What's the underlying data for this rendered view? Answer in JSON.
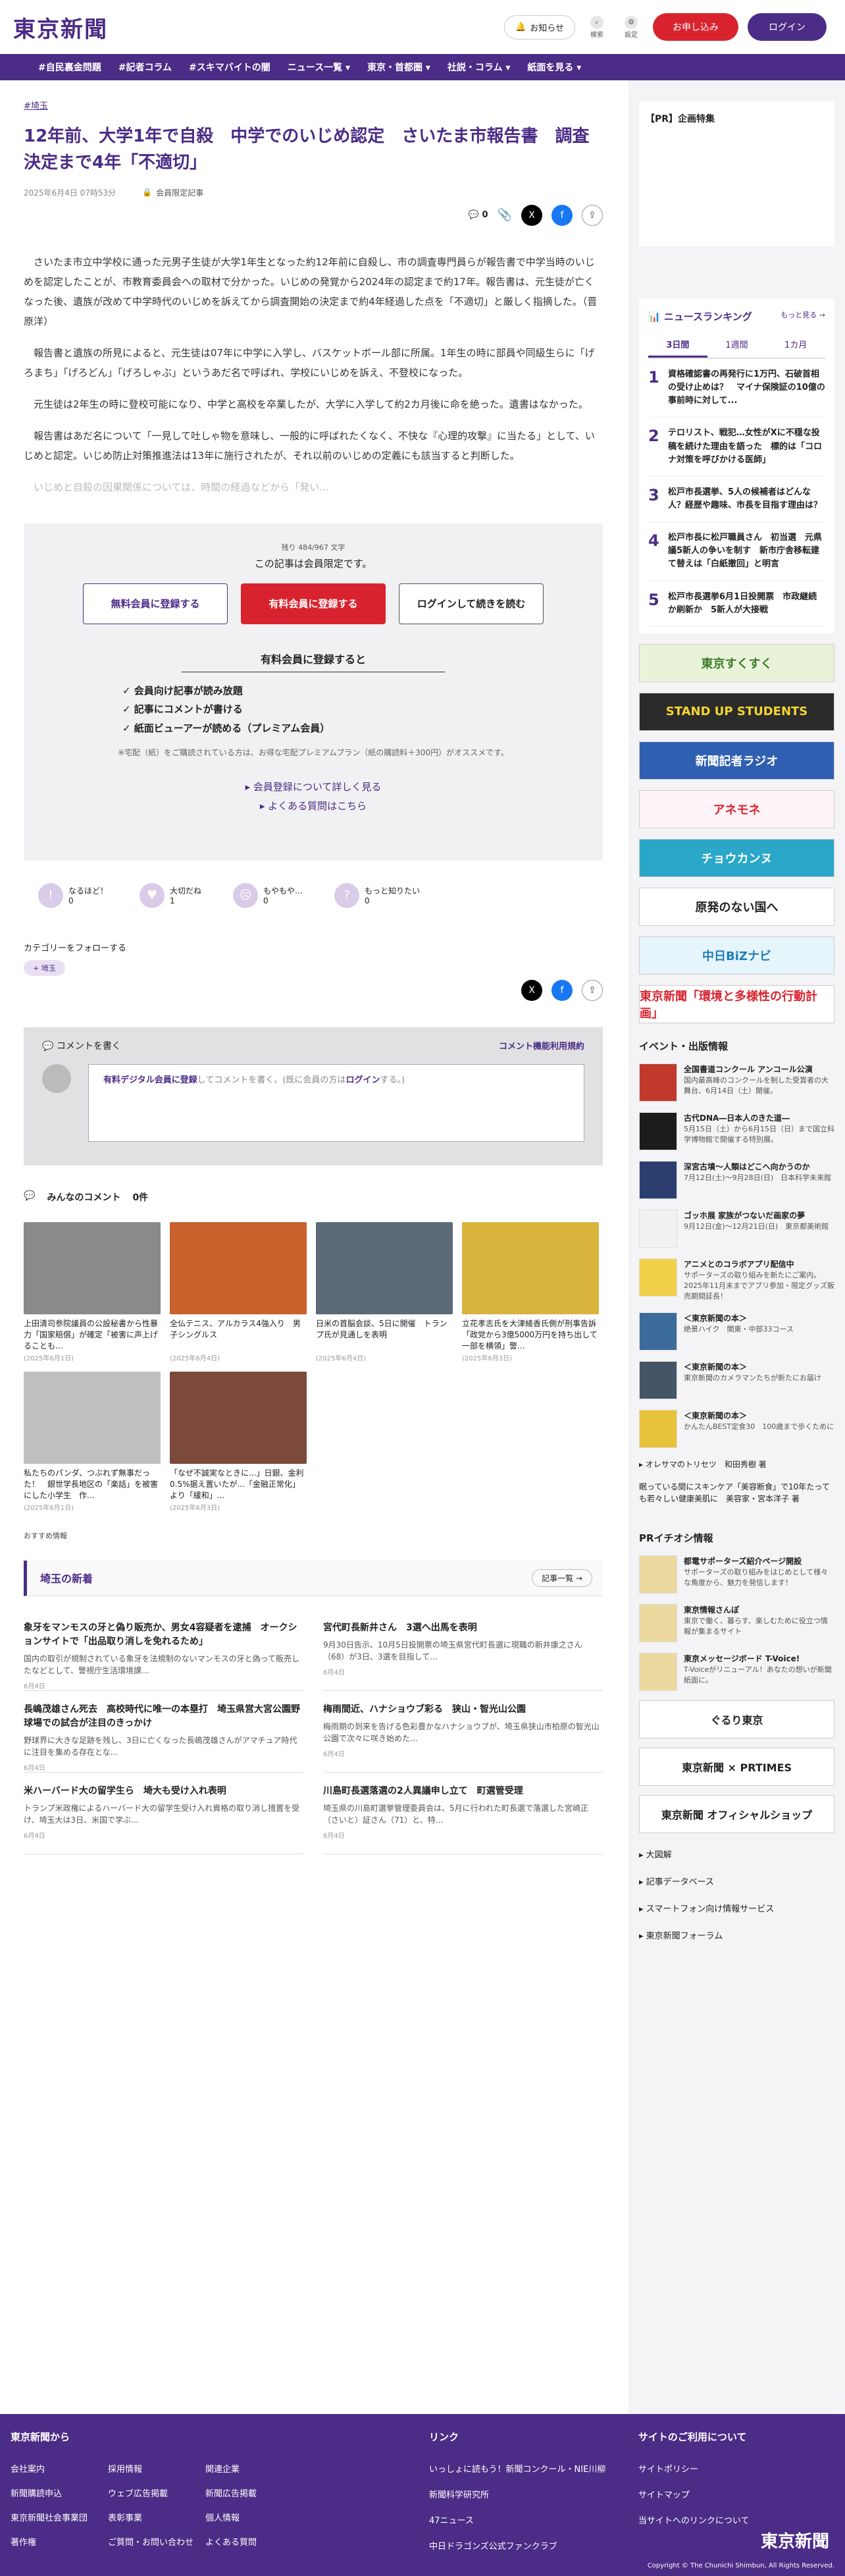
{
  "header": {
    "logo": "東京新聞",
    "notice": "お知らせ",
    "search": "検索",
    "settings": "設定",
    "trial": "お申し込み",
    "login": "ログイン"
  },
  "nav": [
    "#自民裏金問題",
    "#記者コラム",
    "#スキマバイトの闇",
    "ニュース一覧 ▾",
    "東京・首都圏 ▾",
    "社説・コラム ▾",
    "紙面を見る ▾"
  ],
  "article": {
    "tag": "#埼玉",
    "title": "12年前、大学1年で自殺　中学でのいじめ認定　さいたま市報告書　調査決定まで4年「不適切」",
    "date": "2025年6月4日 07時53分",
    "member": "会員限定記事",
    "comments": "0",
    "paragraphs": [
      "さいたま市立中学校に通った元男子生徒が大学1年生となった約12年前に自殺し、市の調査専門員らが報告書で中学当時のいじめを認定したことが、市教育委員会への取材で分かった。いじめの発覚から2024年の認定まで約17年。報告書は、元生徒が亡くなった後、遺族が改めて中学時代のいじめを訴えてから調査開始の決定まで約4年経過した点を「不適切」と厳しく指摘した。（晋原洋）",
      "報告書と遺族の所見によると、元生徒は07年に中学に入学し、バスケットボール部に所属。1年生の時に部員や同級生らに「げろまち」「げろどん」「げろしゃぶ」というあだ名で呼ばれ、学校にいじめを訴え、不登校になった。",
      "元生徒は2年生の時に登校可能になり、中学と高校を卒業したが、大学に入学して約2カ月後に命を絶った。遺書はなかった。",
      "報告書はあだ名について「一見して吐しゃ物を意味し、一般的に呼ばれたくなく、不快な『心理的攻撃』に当たる」として、いじめと認定。いじめ防止対策推進法は13年に施行されたが、それ以前のいじめの定義にも該当すると判断した。"
    ],
    "fade": "いじめと自殺の因果関係については、時間の経過などから「発い…"
  },
  "paywall": {
    "remain": "残り 484/967 文字",
    "title": "この記事は会員限定です。",
    "btn_free": "無料会員に登録する",
    "btn_paid": "有料会員に登録する",
    "btn_login": "ログインして続きを読む",
    "benefits_title": "有料会員に登録すると",
    "benefits": [
      "✓ 会員向け記事が読み放題",
      "✓ 記事にコメントが書ける",
      "✓ 紙面ビューアーが読める（プレミアム会員）"
    ],
    "note": "※宅配（紙）をご購読されている方は、お得な宅配プレミアムプラン（紙の購読料＋300円）がオススメです。",
    "link1": "▸ 会員登録について詳しく見る",
    "link2": "▸ よくある質問はこちら"
  },
  "reactions": [
    {
      "label": "なるほど！",
      "count": "0"
    },
    {
      "label": "大切だね",
      "count": "1"
    },
    {
      "label": "もやもや…",
      "count": "0"
    },
    {
      "label": "もっと知りたい",
      "count": "0"
    }
  ],
  "follow": {
    "title": "カテゴリーをフォローする",
    "chip": "埼玉"
  },
  "comment": {
    "title": "コメントを書く",
    "guide": "コメント機能利用規約",
    "placeholder_lead": "有料デジタル会員に登録",
    "placeholder_mid": "してコメントを書く。(既に会員の方は",
    "placeholder_login": "ログイン",
    "placeholder_end": "する。)"
  },
  "all_comments": {
    "title": "みんなのコメント",
    "count": "0件"
  },
  "photos": [
    {
      "cap": "上田清司参院議員の公設秘書から性暴力「国家賠償」が確定「被害に声上げることも…",
      "dt": "(2025年6月1日)",
      "c": "#8a8a8a"
    },
    {
      "cap": "全仏テニス、アルカラス4強入り　男子シングルス",
      "dt": "(2025年6月4日)",
      "c": "#c8612c"
    },
    {
      "cap": "日米の首脳会談、5日に開催　トランプ氏が見通しを表明",
      "dt": "(2025年6月4日)",
      "c": "#5b6a76"
    },
    {
      "cap": "立花孝志氏を大津綾香氏側が刑事告訴「政党から3億5000万円を持ち出して一部を横領」警...",
      "dt": "(2025年6月3日)",
      "c": "#d9b43c"
    },
    {
      "cap": "私たちのパンダ、つぶれず無事だった！　銀世学長地区の「楽話」を被害にした小学生　作...",
      "dt": "(2025年6月1日)",
      "c": "#bfbfbf"
    },
    {
      "cap": "「なぜ不誠実なときに...」日銀、金利0.5%据え置いたが...「金融正常化」より「緩和」...",
      "dt": "(2025年6月3日)",
      "c": "#7b4a3a"
    }
  ],
  "reco": "おすすめ情報",
  "saitama": {
    "title": "埼玉の新着",
    "more": "記事一覧 →",
    "items": [
      {
        "t": "象牙をマンモスの牙と偽り販売か、男女4容疑者を逮捕　オークションサイトで「出品取り消しを免れるため」",
        "b": "国内の取引が規制されている象牙を法規制のないマンモスの牙と偽って販売したなどとして、警視庁生活環境課...",
        "d": "6月4日"
      },
      {
        "t": "宮代町長新井さん　3選へ出馬を表明",
        "b": "9月30日告示、10月5日投開票の埼玉県宮代町長選に現職の新井康之さん（68）が3日、3選を目指して...",
        "d": "6月4日"
      },
      {
        "t": "長嶋茂雄さん死去　高校時代に唯一の本塁打　埼玉県営大宮公園野球場での試合が注目のきっかけ",
        "b": "野球界に大きな足跡を残し、3日に亡くなった長嶋茂雄さんがアマチュア時代に注目を集める存在とな...",
        "d": "6月4日"
      },
      {
        "t": "梅雨間近、ハナショウブ彩る　狭山・智光山公園",
        "b": "梅雨期の到来を告げる色彩豊かなハナショウブが、埼玉県狭山市柏原の智光山公園で次々に咲き始めた...",
        "d": "6月4日"
      },
      {
        "t": "米ハーバード大の留学生ら　埼大も受け入れ表明",
        "b": "トランプ米政権によるハーバード大の留学生受け入れ資格の取り消し措置を受け、埼玉大は3日、米国で学ぶ...",
        "d": "6月4日"
      },
      {
        "t": "川島町長選落選の2人異議申し立て　町選管受理",
        "b": "埼玉県の川島町選挙管理委員会は、5月に行われた町長選で落選した宮崎正（さいと）証さん（71）と、特...",
        "d": "6月4日"
      }
    ]
  },
  "side": {
    "pr": "【PR】企画特集",
    "ranking_title": "ニュースランキング",
    "ranking_more": "もっと見る →",
    "tabs": [
      "3日間",
      "1週間",
      "1カ月"
    ],
    "ranks": [
      "資格確認書の再発行に1万円、石破首相の受け止めは？　マイナ保険証の10億の事前時に対して...",
      "テロリスト、戦犯…女性がXに不穏な投稿を続けた理由を語った　標的は「コロナ対策を呼びかける医師」",
      "松戸市長選挙、5人の候補者はどんな人？経歴や趣味、市長を目指す理由は？",
      "松戸市長に松戸職員さん　初当選　元県議5新人の争いを制す　新市庁舎移転建て替えは「白紙撤回」と明言",
      "松戸市長選挙6月1日投開票　市政継続か刷新か　5新人が大接戦"
    ],
    "banners": [
      {
        "t": "東京すくすく",
        "bg": "#e9f3d9",
        "c": "#3a7a28"
      },
      {
        "t": "STAND UP STUDENTS",
        "bg": "#2b2b2b",
        "c": "#f4d432"
      },
      {
        "t": "新聞記者ラジオ",
        "bg": "#2f5fb0",
        "c": "#fff"
      },
      {
        "t": "アネモネ",
        "bg": "#fff4f8",
        "c": "#d8232f"
      },
      {
        "t": "チョウカンヌ",
        "bg": "#2aa7c9",
        "c": "#fff"
      },
      {
        "t": "原発のない国へ",
        "bg": "#fff",
        "c": "#222"
      },
      {
        "t": "中日BiZナビ",
        "bg": "#e6f4fb",
        "c": "#1f7db8"
      },
      {
        "t": "東京新聞「環境と多様性の行動計画」",
        "bg": "#fff",
        "c": "#d8232f"
      }
    ],
    "events_title": "イベント・出版情報",
    "events": [
      {
        "t": "全国書道コンクール アンコール公演",
        "b": "国内最高峰のコンクールを制した受賞者の大舞台、6月14日（土）開催。",
        "c": "#c0392b"
      },
      {
        "t": "古代DNA―日本人のきた道―",
        "b": "5月15日（土）から6月15日（日）まで国立科学博物館で開催する特別展。",
        "c": "#1c1c1c"
      },
      {
        "t": "深宮古墳〜人類はどこへ向かうのか",
        "b": "7月12日(土)〜9月28日(日)　日本科学未来館",
        "c": "#2c3e70"
      },
      {
        "t": "ゴッホ展 家族がつないだ画家の夢",
        "b": "9月12日(金)〜12月21日(日)　東京都美術館",
        "c": "#f1f1f1"
      },
      {
        "t": "アニメとのコラボアプリ配信中",
        "b": "サポーターズの取り組みを新たにご案内。2025年11月末までアプリ参加・限定グッズ販売期間延長！",
        "c": "#f2d14a"
      },
      {
        "t": "＜東京新聞の本＞",
        "b": "絶景ハイク　関東・中部33コース",
        "c": "#3a6b9a"
      },
      {
        "t": "＜東京新聞の本＞",
        "b": "東京新聞のカメラマンたちが新たにお届け",
        "c": "#445566"
      },
      {
        "t": "＜東京新聞の本＞",
        "b": "かんたんBEST定食30　100歳まで歩くために",
        "c": "#e8c23a"
      }
    ],
    "links_a": [
      "▸ オレサマのトリセツ　和田秀樹 著",
      "眠っている間にスキンケア「美容断食」で10年たっても若々しい健康美肌に　美容家・宮本洋子 著"
    ],
    "pr_title": "PRイチオシ情報",
    "pr_items": [
      {
        "t": "都電サポーターズ紹介ページ開設",
        "b": "サポーターズの取り組みをはじめとして様々な角度から、魅力を発信します！"
      },
      {
        "t": "東京情報さんぽ",
        "b": "東京で働く、暮らす、楽しむために役立つ情報が集まるサイト"
      },
      {
        "t": "東京メッセージボード T-Voice!",
        "b": "T-Voiceがリニューアル！あなたの想いが新聞紙面に。"
      }
    ],
    "bottom_banners": [
      "ぐるり東京",
      "東京新聞 × PRTIMES",
      "東京新聞 オフィシャルショップ"
    ],
    "bottom_links": [
      "▸ 大図解",
      "▸ 記事データベース",
      "▸ スマートフォン向け情報サービス",
      "▸ 東京新聞フォーラム"
    ]
  },
  "footer": {
    "col1_title": "東京新聞から",
    "col1": [
      "会社案内",
      "採用情報",
      "関連企業",
      "新聞購読申込",
      "ウェブ広告掲載",
      "新聞広告掲載",
      "東京新聞社会事業団",
      "表彰事業",
      "個人情報",
      "著作権",
      "ご質問・お問い合わせ",
      "よくある質問"
    ],
    "col2_title": "リンク",
    "col2": [
      "いっしょに読もう！新聞コンクール・NIE川柳",
      "新聞科学研究所",
      "47ニュース",
      "中日ドラゴンズ公式ファンクラブ"
    ],
    "col3_title": "サイトのご利用について",
    "col3": [
      "サイトポリシー",
      "サイトマップ",
      "当サイトへのリンクについて"
    ],
    "logo": "東京新聞",
    "copyright": "Copyright © The Chunichi Shimbun, All Rights Reserved."
  }
}
